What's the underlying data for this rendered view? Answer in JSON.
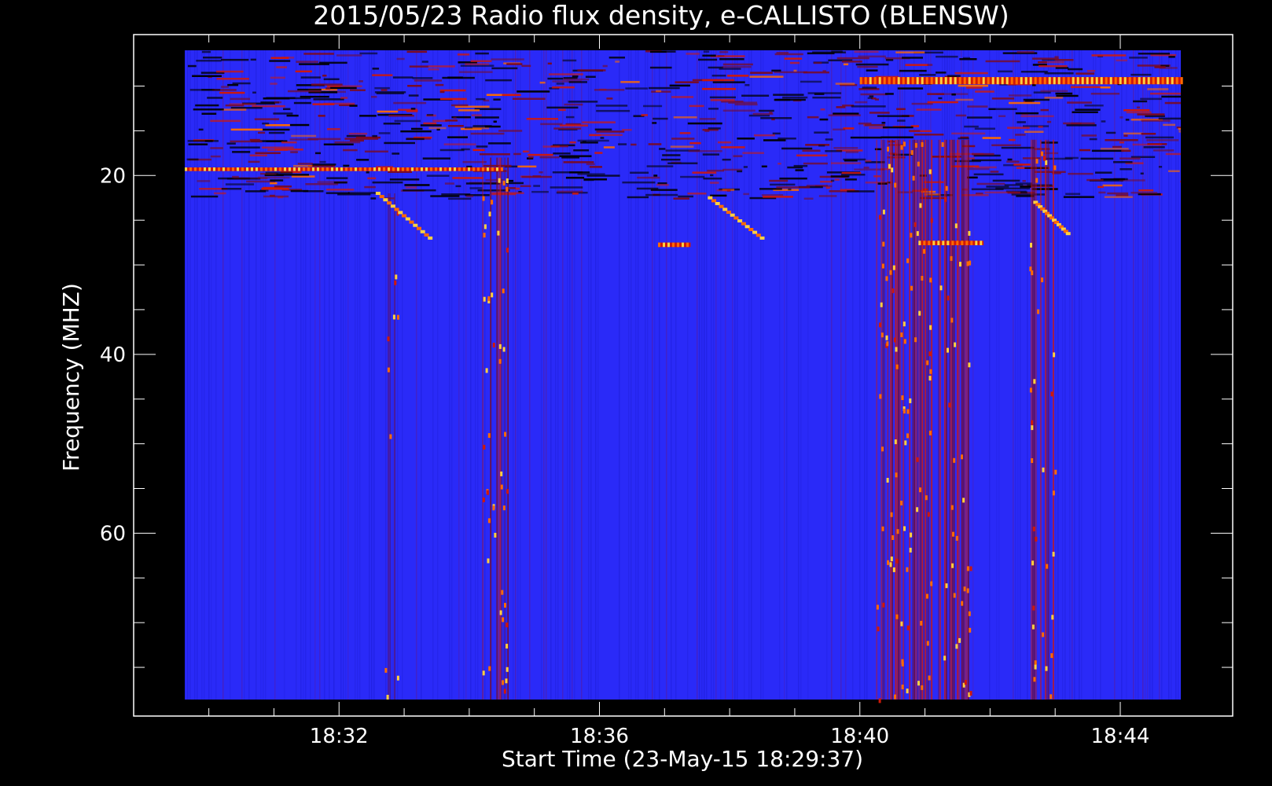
{
  "chart_data": {
    "type": "heatmap",
    "title": "2015/05/23  Radio flux density, e-CALLISTO (BLENSW)",
    "xlabel": "Start Time (23-May-15 18:29:37)",
    "ylabel": "Frequency (MHZ)",
    "x_ticks": [
      {
        "label": "18:32",
        "minutes": 32
      },
      {
        "label": "18:36",
        "minutes": 36
      },
      {
        "label": "18:40",
        "minutes": 40
      },
      {
        "label": "18:44",
        "minutes": 44
      }
    ],
    "y_ticks": [
      {
        "label": "20",
        "value": 20
      },
      {
        "label": "40",
        "value": 40
      },
      {
        "label": "60",
        "value": 60
      }
    ],
    "xlim_minutes": [
      29.63,
      44.93
    ],
    "ylim_mhz": [
      6,
      78.6
    ],
    "y_axis_inverted": true,
    "colormap": [
      "#000000",
      "#1a1ac8",
      "#2a2af8",
      "#7a0a20",
      "#d01808",
      "#ff6a00",
      "#ffd040"
    ],
    "background_color": "#2a2af8",
    "events": [
      {
        "kind": "broadband burst",
        "start_min": 34.2,
        "end_min": 34.6,
        "freq_low": 18,
        "freq_high": 78.6,
        "intensity": 0.95
      },
      {
        "kind": "broadband burst",
        "start_min": 40.25,
        "end_min": 41.1,
        "freq_low": 16,
        "freq_high": 78.6,
        "intensity": 0.9
      },
      {
        "kind": "broadband burst",
        "start_min": 41.2,
        "end_min": 41.7,
        "freq_low": 16,
        "freq_high": 78.6,
        "intensity": 0.6
      },
      {
        "kind": "broadband burst",
        "start_min": 42.6,
        "end_min": 43.0,
        "freq_low": 16,
        "freq_high": 78.6,
        "intensity": 0.7
      },
      {
        "kind": "broadband burst",
        "start_min": 32.7,
        "end_min": 32.9,
        "freq_low": 22,
        "freq_high": 78.6,
        "intensity": 0.45
      },
      {
        "kind": "drifting burst",
        "start_min": 32.6,
        "end_min": 33.4,
        "freq_start": 22,
        "freq_end": 27,
        "intensity": 0.9
      },
      {
        "kind": "drifting burst",
        "start_min": 37.7,
        "end_min": 38.5,
        "freq_start": 22.5,
        "freq_end": 27,
        "intensity": 0.9
      },
      {
        "kind": "drifting burst",
        "start_min": 42.7,
        "end_min": 43.2,
        "freq_start": 23,
        "freq_end": 26.5,
        "intensity": 0.9
      },
      {
        "kind": "interference line",
        "start_min": 29.63,
        "end_min": 34.5,
        "freq_low": 19.1,
        "freq_high": 19.5,
        "intensity": 0.9
      },
      {
        "kind": "interference line",
        "start_min": 40.0,
        "end_min": 44.93,
        "freq_low": 9.0,
        "freq_high": 9.8,
        "intensity": 0.95
      },
      {
        "kind": "interference line",
        "start_min": 40.9,
        "end_min": 41.9,
        "freq_low": 27.3,
        "freq_high": 27.8,
        "intensity": 0.8
      },
      {
        "kind": "interference line",
        "start_min": 36.9,
        "end_min": 37.4,
        "freq_low": 27.5,
        "freq_high": 28.0,
        "intensity": 0.6
      }
    ]
  }
}
